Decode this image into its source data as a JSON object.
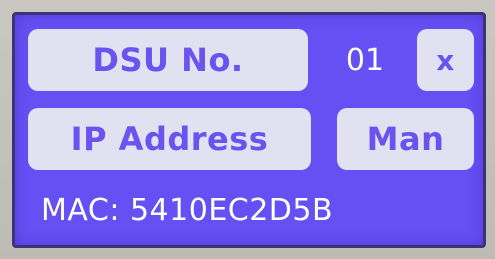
{
  "dsu": {
    "label": "DSU No.",
    "value": "01"
  },
  "close_button": {
    "label": "x",
    "icon": "close-icon"
  },
  "ip": {
    "label": "IP Address"
  },
  "mode": {
    "label": "Man"
  },
  "mac": {
    "text": "MAC: 5410EC2D5B"
  },
  "colors": {
    "screen_background": "#6650f3",
    "button_background": "#e2e1f1",
    "button_text": "#6a53ee",
    "value_text": "#ffffff",
    "bezel": "#c5c3bb"
  }
}
